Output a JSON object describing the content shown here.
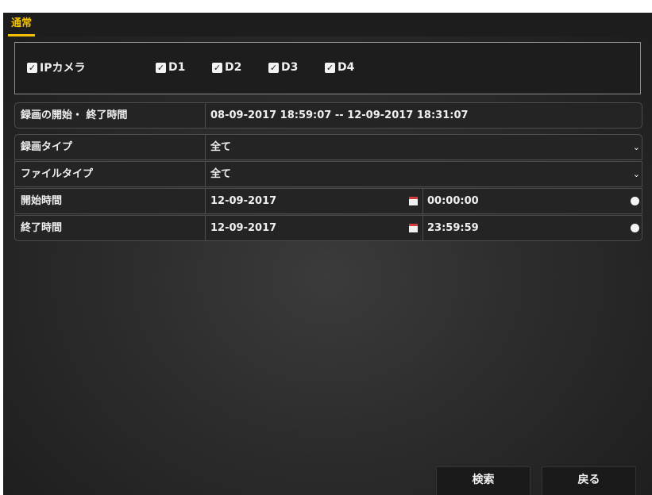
{
  "tab": {
    "label": "通常"
  },
  "cameras": [
    {
      "label": "IPカメラ",
      "checked": true
    },
    {
      "label": "D1",
      "checked": true
    },
    {
      "label": "D2",
      "checked": true
    },
    {
      "label": "D3",
      "checked": true
    },
    {
      "label": "D4",
      "checked": true
    }
  ],
  "fields": {
    "record_range": {
      "label": "録画の開始・ 終了時間",
      "value": "08-09-2017 18:59:07 -- 12-09-2017 18:31:07"
    },
    "record_type": {
      "label": "録画タイプ",
      "value": "全て"
    },
    "file_type": {
      "label": "ファイルタイプ",
      "value": "全て"
    },
    "start_time": {
      "label": "開始時間",
      "date": "12-09-2017",
      "time": "00:00:00"
    },
    "end_time": {
      "label": "終了時間",
      "date": "12-09-2017",
      "time": "23:59:59"
    }
  },
  "buttons": {
    "search": "検索",
    "back": "戻る"
  },
  "icons": {
    "checkbox": "check-icon",
    "dropdown": "chevron-down-icon",
    "date": "calendar-icon",
    "time": "clock-icon"
  },
  "colors": {
    "accent": "#f2c000",
    "background": "#2c2c2c",
    "text": "#f0f0f0"
  }
}
